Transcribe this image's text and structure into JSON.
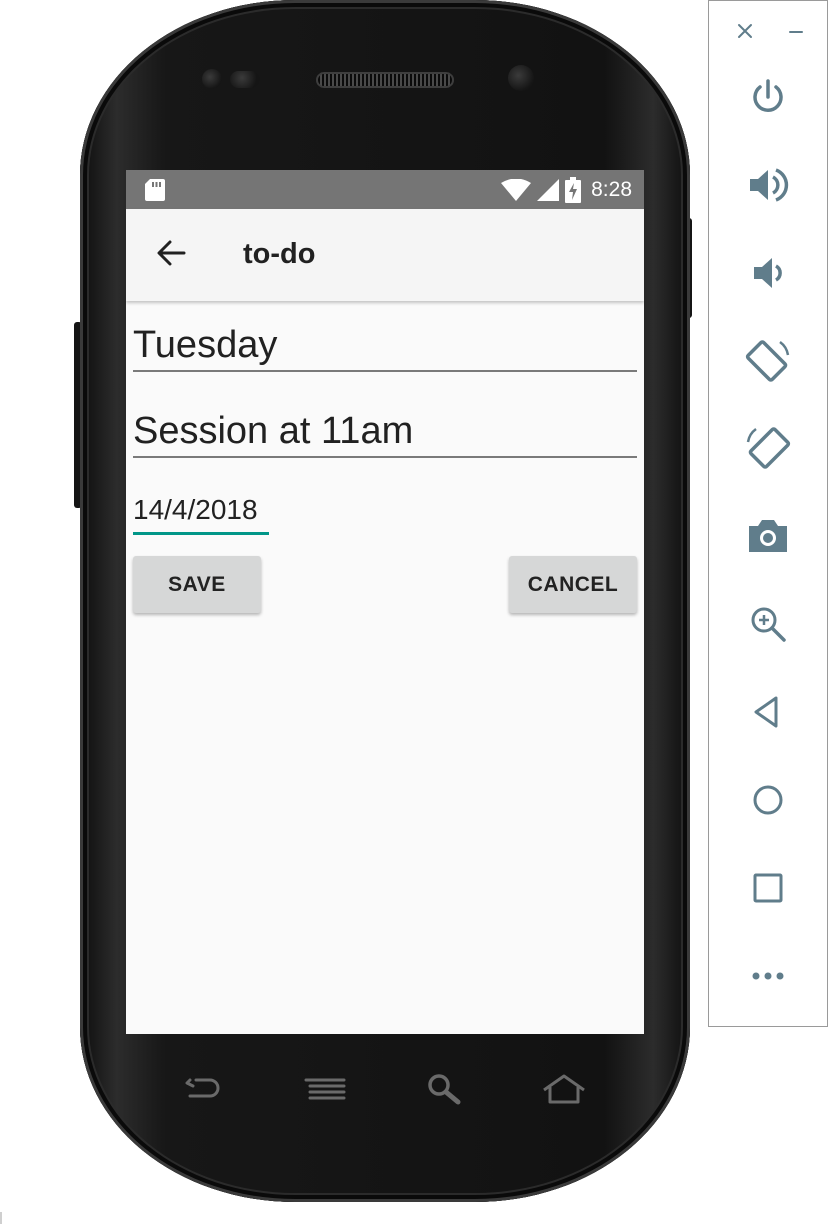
{
  "status_bar": {
    "time": "8:28"
  },
  "app_bar": {
    "title": "to-do",
    "back_icon": "arrow-back-icon"
  },
  "form": {
    "day_value": "Tuesday",
    "description_value": "Session at 11am",
    "date_value": "14/4/2018"
  },
  "buttons": {
    "save_label": "SAVE",
    "cancel_label": "CANCEL"
  },
  "colors": {
    "accent": "#009688",
    "status_bar": "#757575",
    "app_bar": "#f5f5f5",
    "screen_bg": "#fafafa",
    "button_bg": "#d6d7d7",
    "toolbar_icon": "#607d8b"
  },
  "hardware_keys": [
    "back-icon",
    "menu-icon",
    "search-icon",
    "home-icon"
  ],
  "emulator_toolbar": {
    "window_controls": [
      "close-icon",
      "minimize-icon"
    ],
    "items": [
      {
        "icon": "power-icon"
      },
      {
        "icon": "volume-up-icon"
      },
      {
        "icon": "volume-down-icon"
      },
      {
        "icon": "rotate-left-icon"
      },
      {
        "icon": "rotate-right-icon"
      },
      {
        "icon": "camera-icon"
      },
      {
        "icon": "zoom-icon"
      },
      {
        "icon": "back-icon"
      },
      {
        "icon": "home-icon"
      },
      {
        "icon": "overview-icon"
      },
      {
        "icon": "more-icon"
      }
    ]
  }
}
